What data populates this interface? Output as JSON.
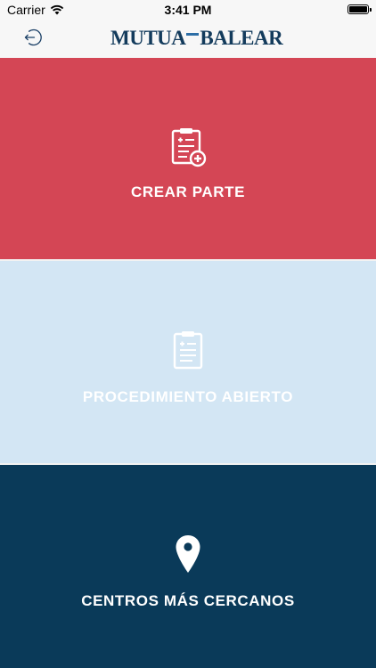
{
  "status_bar": {
    "carrier": "Carrier",
    "time": "3:41 PM",
    "icons": [
      "wifi-icon",
      "battery-icon"
    ]
  },
  "nav_bar": {
    "back_icon": "back-arrow-icon",
    "brand_left": "MUTUA",
    "brand_right": "BALEAR",
    "brand_color": "#133b5c"
  },
  "tiles": [
    {
      "label": "CREAR PARTE",
      "icon": "clipboard-add-icon",
      "background": "#d44655"
    },
    {
      "label": "PROCEDIMIENTO ABIERTO",
      "icon": "clipboard-icon",
      "background": "#d3e6f4"
    },
    {
      "label": "CENTROS MÁS CERCANOS",
      "icon": "location-pin-icon",
      "background": "#0a3a59"
    }
  ]
}
